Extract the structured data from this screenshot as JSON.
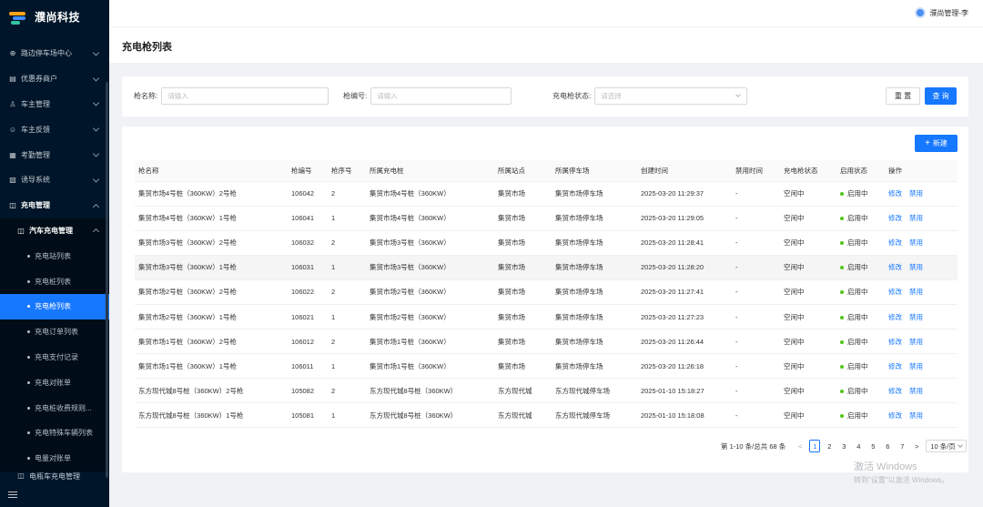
{
  "brand": {
    "name": "濮尚科技"
  },
  "header": {
    "user_name": "濮尚管理-李"
  },
  "sidebar": {
    "items": [
      {
        "label": "路边停车场中心",
        "icon": "parking-icon",
        "glyph": "⊕"
      },
      {
        "label": "优惠券商户",
        "icon": "coupon-icon",
        "glyph": "▤"
      },
      {
        "label": "车主管理",
        "icon": "user-icon",
        "glyph": "♙"
      },
      {
        "label": "车主反馈",
        "icon": "feedback-icon",
        "glyph": "☺"
      },
      {
        "label": "考勤管理",
        "icon": "attendance-icon",
        "glyph": "▦"
      },
      {
        "label": "诱导系统",
        "icon": "guide-icon",
        "glyph": "▧"
      },
      {
        "label": "充电管理",
        "icon": "charging-icon",
        "glyph": "◫"
      }
    ],
    "group": {
      "label": "汽车充电管理",
      "icon": "car-charging-icon",
      "glyph": "◫"
    },
    "sub_items": [
      {
        "label": "充电站列表",
        "active": false
      },
      {
        "label": "充电桩列表",
        "active": false
      },
      {
        "label": "充电枪列表",
        "active": true
      },
      {
        "label": "充电订单列表",
        "active": false
      },
      {
        "label": "充电支付记录",
        "active": false
      },
      {
        "label": "充电对账单",
        "active": false
      },
      {
        "label": "充电桩收费规则...",
        "active": false
      },
      {
        "label": "充电特殊车辆列表",
        "active": false
      },
      {
        "label": "电量对账单",
        "active": false
      }
    ],
    "cutoff_label": "电瓶车充电管理"
  },
  "page": {
    "title": "充电枪列表"
  },
  "search": {
    "gun_name_label": "枪名称:",
    "gun_name_placeholder": "请输入",
    "gun_no_label": "枪编号:",
    "gun_no_placeholder": "请输入",
    "status_label": "充电枪状态:",
    "status_placeholder": "请选择",
    "reset_label": "重 置",
    "query_label": "查 询"
  },
  "toolbar": {
    "add_label": "新建"
  },
  "table": {
    "columns": [
      "枪名称",
      "枪编号",
      "枪序号",
      "所属充电桩",
      "所属站点",
      "所属停车场",
      "创建时间",
      "禁用时间",
      "充电枪状态",
      "启用状态",
      "操作"
    ],
    "rows": [
      {
        "name": "集贸市场4号桩（360KW）2号枪",
        "no": "106042",
        "seq": "2",
        "pile": "集贸市场4号桩（360KW）",
        "site": "集贸市场",
        "lot": "集贸市场停车场",
        "created": "2025-03-20 11:29:37",
        "disabled_at": "-",
        "gun_status": "空闲中",
        "enable_status": "启用中",
        "edit": "修改",
        "disable": "禁用"
      },
      {
        "name": "集贸市场4号桩（360KW）1号枪",
        "no": "106041",
        "seq": "1",
        "pile": "集贸市场4号桩（360KW）",
        "site": "集贸市场",
        "lot": "集贸市场停车场",
        "created": "2025-03-20 11:29:05",
        "disabled_at": "-",
        "gun_status": "空闲中",
        "enable_status": "启用中",
        "edit": "修改",
        "disable": "禁用"
      },
      {
        "name": "集贸市场3号桩（360KW）2号枪",
        "no": "106032",
        "seq": "2",
        "pile": "集贸市场3号桩（360KW）",
        "site": "集贸市场",
        "lot": "集贸市场停车场",
        "created": "2025-03-20 11:28:41",
        "disabled_at": "-",
        "gun_status": "空闲中",
        "enable_status": "启用中",
        "edit": "修改",
        "disable": "禁用"
      },
      {
        "name": "集贸市场3号桩（360KW）1号枪",
        "no": "106031",
        "seq": "1",
        "pile": "集贸市场3号桩（360KW）",
        "site": "集贸市场",
        "lot": "集贸市场停车场",
        "created": "2025-03-20 11:28:20",
        "disabled_at": "-",
        "gun_status": "空闲中",
        "enable_status": "启用中",
        "edit": "修改",
        "disable": "禁用"
      },
      {
        "name": "集贸市场2号桩（360KW）2号枪",
        "no": "106022",
        "seq": "2",
        "pile": "集贸市场2号桩（360KW）",
        "site": "集贸市场",
        "lot": "集贸市场停车场",
        "created": "2025-03-20 11:27:41",
        "disabled_at": "-",
        "gun_status": "空闲中",
        "enable_status": "启用中",
        "edit": "修改",
        "disable": "禁用"
      },
      {
        "name": "集贸市场2号桩（360KW）1号枪",
        "no": "106021",
        "seq": "1",
        "pile": "集贸市场2号桩（360KW）",
        "site": "集贸市场",
        "lot": "集贸市场停车场",
        "created": "2025-03-20 11:27:23",
        "disabled_at": "-",
        "gun_status": "空闲中",
        "enable_status": "启用中",
        "edit": "修改",
        "disable": "禁用"
      },
      {
        "name": "集贸市场1号桩（360KW）2号枪",
        "no": "106012",
        "seq": "2",
        "pile": "集贸市场1号桩（360KW）",
        "site": "集贸市场",
        "lot": "集贸市场停车场",
        "created": "2025-03-20 11:26:44",
        "disabled_at": "-",
        "gun_status": "空闲中",
        "enable_status": "启用中",
        "edit": "修改",
        "disable": "禁用"
      },
      {
        "name": "集贸市场1号桩（360KW）1号枪",
        "no": "106011",
        "seq": "1",
        "pile": "集贸市场1号桩（360KW）",
        "site": "集贸市场",
        "lot": "集贸市场停车场",
        "created": "2025-03-20 11:26:18",
        "disabled_at": "-",
        "gun_status": "空闲中",
        "enable_status": "启用中",
        "edit": "修改",
        "disable": "禁用"
      },
      {
        "name": "东方现代城8号桩（360KW）2号枪",
        "no": "105082",
        "seq": "2",
        "pile": "东方现代城8号桩（360KW）",
        "site": "东方现代城",
        "lot": "东方现代城停车场",
        "created": "2025-01-10 15:18:27",
        "disabled_at": "-",
        "gun_status": "空闲中",
        "enable_status": "启用中",
        "edit": "修改",
        "disable": "禁用"
      },
      {
        "name": "东方现代城8号桩（360KW）1号枪",
        "no": "105081",
        "seq": "1",
        "pile": "东方现代城8号桩（360KW）",
        "site": "东方现代城",
        "lot": "东方现代城停车场",
        "created": "2025-01-10 15:18:08",
        "disabled_at": "-",
        "gun_status": "空闲中",
        "enable_status": "启用中",
        "edit": "修改",
        "disable": "禁用"
      }
    ],
    "highlighted_row": 3
  },
  "pagination": {
    "summary": "第 1-10 条/总共 68 条",
    "prev": "<",
    "next": ">",
    "pages": [
      "1",
      "2",
      "3",
      "4",
      "5",
      "6",
      "7"
    ],
    "current_page": "1",
    "page_size": "10 条/页"
  },
  "watermark": {
    "title": "激活 Windows",
    "subtitle": "转到\"设置\"以激活 Windows。"
  },
  "colors": {
    "sidebar_bg": "#001529",
    "primary": "#1677ff",
    "success": "#52c41a"
  }
}
